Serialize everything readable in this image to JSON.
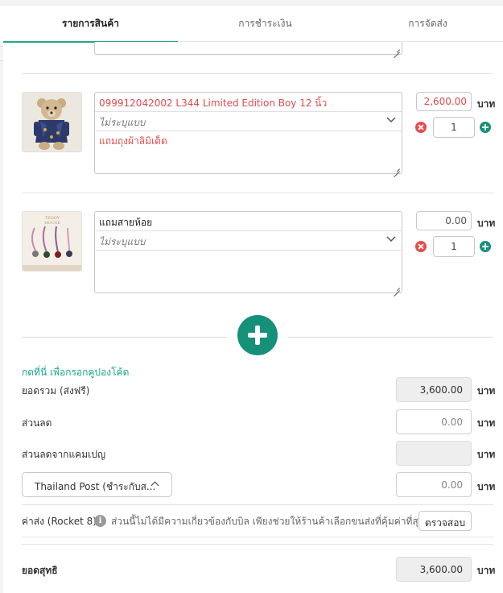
{
  "tabs": [
    {
      "label": "รายการสินค้า",
      "active": true
    },
    {
      "label": "การชำระเงิน",
      "active": false
    },
    {
      "label": "การจัดส่ง",
      "active": false
    }
  ],
  "currency": "บาท",
  "items": [
    {
      "name": "099912042002 L344 Limited Edition Boy 12 นิ้ว",
      "variant_placeholder": "ไม่ระบุแบบ",
      "note": "แถมถุงผ้าลิมิเต็ด",
      "price": "2,600.00",
      "quantity": "1",
      "thumbnail": "teddy-bear-product-image"
    },
    {
      "name": "แถมสายห้อย",
      "variant_placeholder": "ไม่ระบุแบบ",
      "note": "",
      "price": "0.00",
      "quantity": "1",
      "thumbnail": "lanyard-straps-product-image",
      "thumbnail_brand": "TEDDY HOUSE"
    }
  ],
  "coupon_link": "กดที่นี่ เพื่อกรอกคูปองโค้ด",
  "summary": {
    "subtotal_label": "ยอดรวม (ส่งฟรี)",
    "subtotal_value": "3,600.00",
    "discount_label": "ส่วนลด",
    "discount_value": "0.00",
    "campaign_discount_label": "ส่วนลดจากแคมเปญ",
    "campaign_discount_value": "",
    "shipping_method": "Thailand Post (ชำระกับส...",
    "shipping_value": "0.00",
    "rocket_label": "ค่าส่ง (Rocket 8)",
    "rocket_note": "ส่วนนี้ไม่ได้มีความเกี่ยวข้องกับบิล เพียงช่วยให้ร้านค้าเลือกขนส่งที่คุ้มค่าที่สุด",
    "check_button": "ตรวจสอบ",
    "total_label": "ยอดสุทธิ",
    "total_value": "3,600.00"
  },
  "colors": {
    "accent": "#15917a",
    "tab_underline": "#22a58d",
    "price_red": "#e04b4b",
    "remove_red": "#e74c4c"
  }
}
